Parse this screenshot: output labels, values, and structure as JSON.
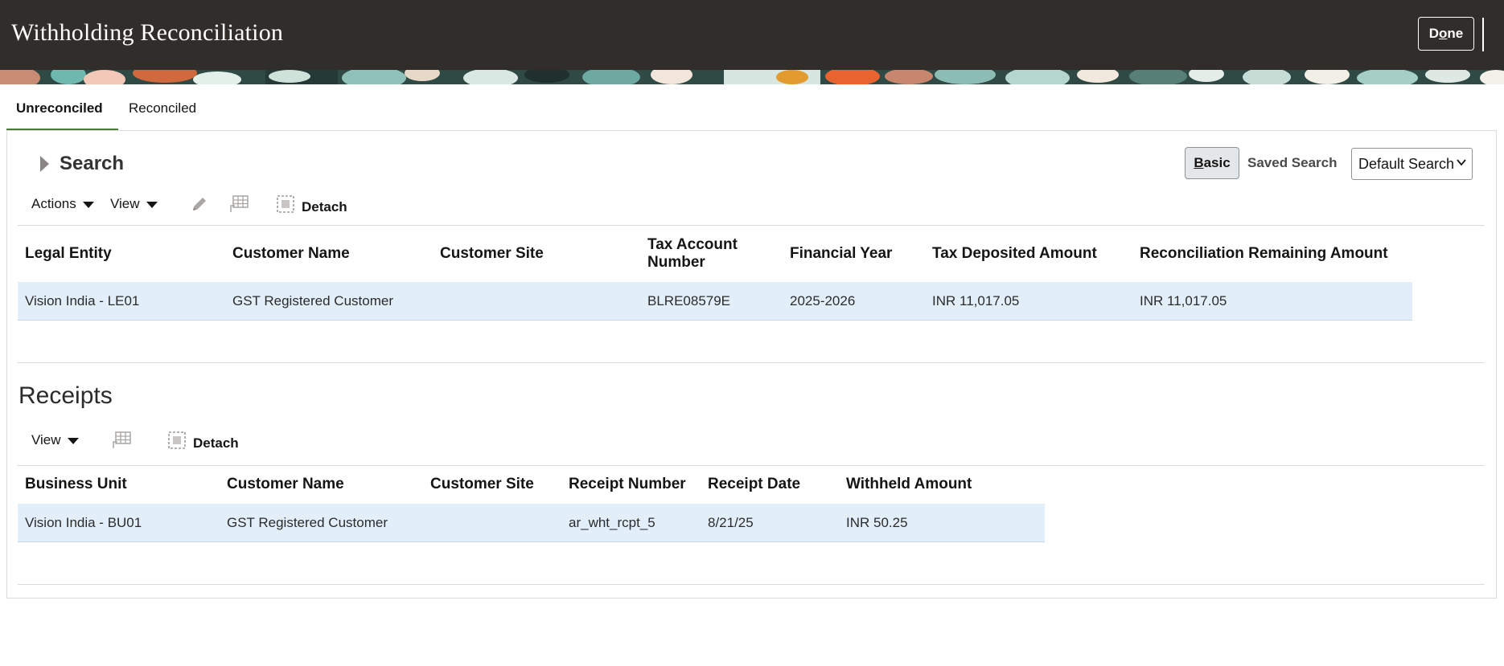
{
  "header": {
    "title": "Withholding Reconciliation",
    "done_prefix": "D",
    "done_underlined": "o",
    "done_suffix": "ne"
  },
  "tabs": [
    {
      "label": "Unreconciled",
      "selected": true
    },
    {
      "label": "Reconciled",
      "selected": false
    }
  ],
  "search": {
    "title": "Search",
    "basic_underlined": "B",
    "basic_rest": "asic",
    "saved_search_label": "Saved Search",
    "saved_search_value": "Default Search"
  },
  "toolbar": {
    "actions_label": "Actions",
    "view_label": "View",
    "detach_label": "Detach"
  },
  "results_table": {
    "columns": [
      "Legal Entity",
      "Customer Name",
      "Customer Site",
      "Tax Account Number",
      "Financial Year",
      "Tax Deposited Amount",
      "Reconciliation Remaining Amount"
    ],
    "tax_account_line1": "Tax Account",
    "tax_account_line2": "Number",
    "rows": [
      [
        "Vision India - LE01",
        "GST Registered Customer",
        "",
        "BLRE08579E",
        "2025-2026",
        "INR 11,017.05",
        "INR 11,017.05"
      ]
    ]
  },
  "receipts": {
    "title": "Receipts",
    "view_label": "View",
    "detach_label": "Detach",
    "columns": [
      "Business Unit",
      "Customer Name",
      "Customer Site",
      "Receipt Number",
      "Receipt Date",
      "Withheld Amount"
    ],
    "rows": [
      [
        "Vision India - BU01",
        "GST Registered Customer",
        "",
        "ar_wht_rcpt_5",
        "8/21/25",
        "INR 50.25"
      ]
    ]
  },
  "colors": {
    "header_bg": "#312d2a",
    "tab_accent": "#4c7a3e",
    "row_highlight": "#e2effb"
  },
  "icons": [
    "pencil-icon",
    "freeze-columns-icon",
    "detach-icon",
    "disclosure-triangle-icon",
    "chevron-down-icon"
  ]
}
